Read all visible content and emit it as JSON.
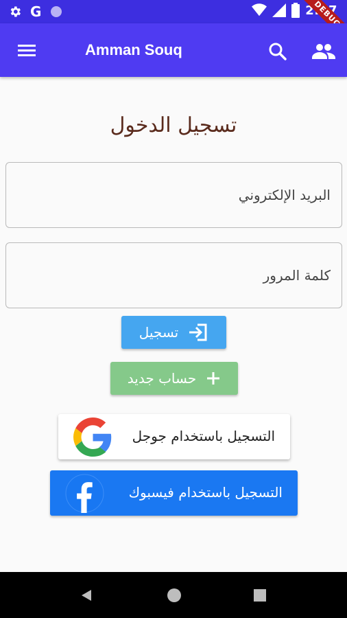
{
  "status_bar": {
    "time": "2:57",
    "debug_label": "DEBUG",
    "icons": [
      "gear-icon",
      "google-g-icon",
      "circle-icon",
      "wifi-icon",
      "signal-icon",
      "battery-icon"
    ]
  },
  "app_bar": {
    "title": "Amman Souq",
    "icons": [
      "menu-icon",
      "search-icon",
      "people-icon"
    ],
    "color": "#4f3bf2"
  },
  "login": {
    "title": "تسجيل الدخول",
    "email_placeholder": "البريد الإلكتروني",
    "password_placeholder": "كلمة المرور",
    "login_label": "تسجيل",
    "register_label": "حساب جديد",
    "google_label": "التسجيل باستخدام جوجل",
    "facebook_label": "التسجيل باستخدام فيسبوك"
  },
  "colors": {
    "login_button": "#45a6f0",
    "register_button": "#85c98a",
    "facebook_button": "#1a78f2",
    "title_text": "#5a2b1d"
  },
  "nav_bar": {
    "icons": [
      "back-icon",
      "home-icon",
      "recents-icon"
    ]
  }
}
